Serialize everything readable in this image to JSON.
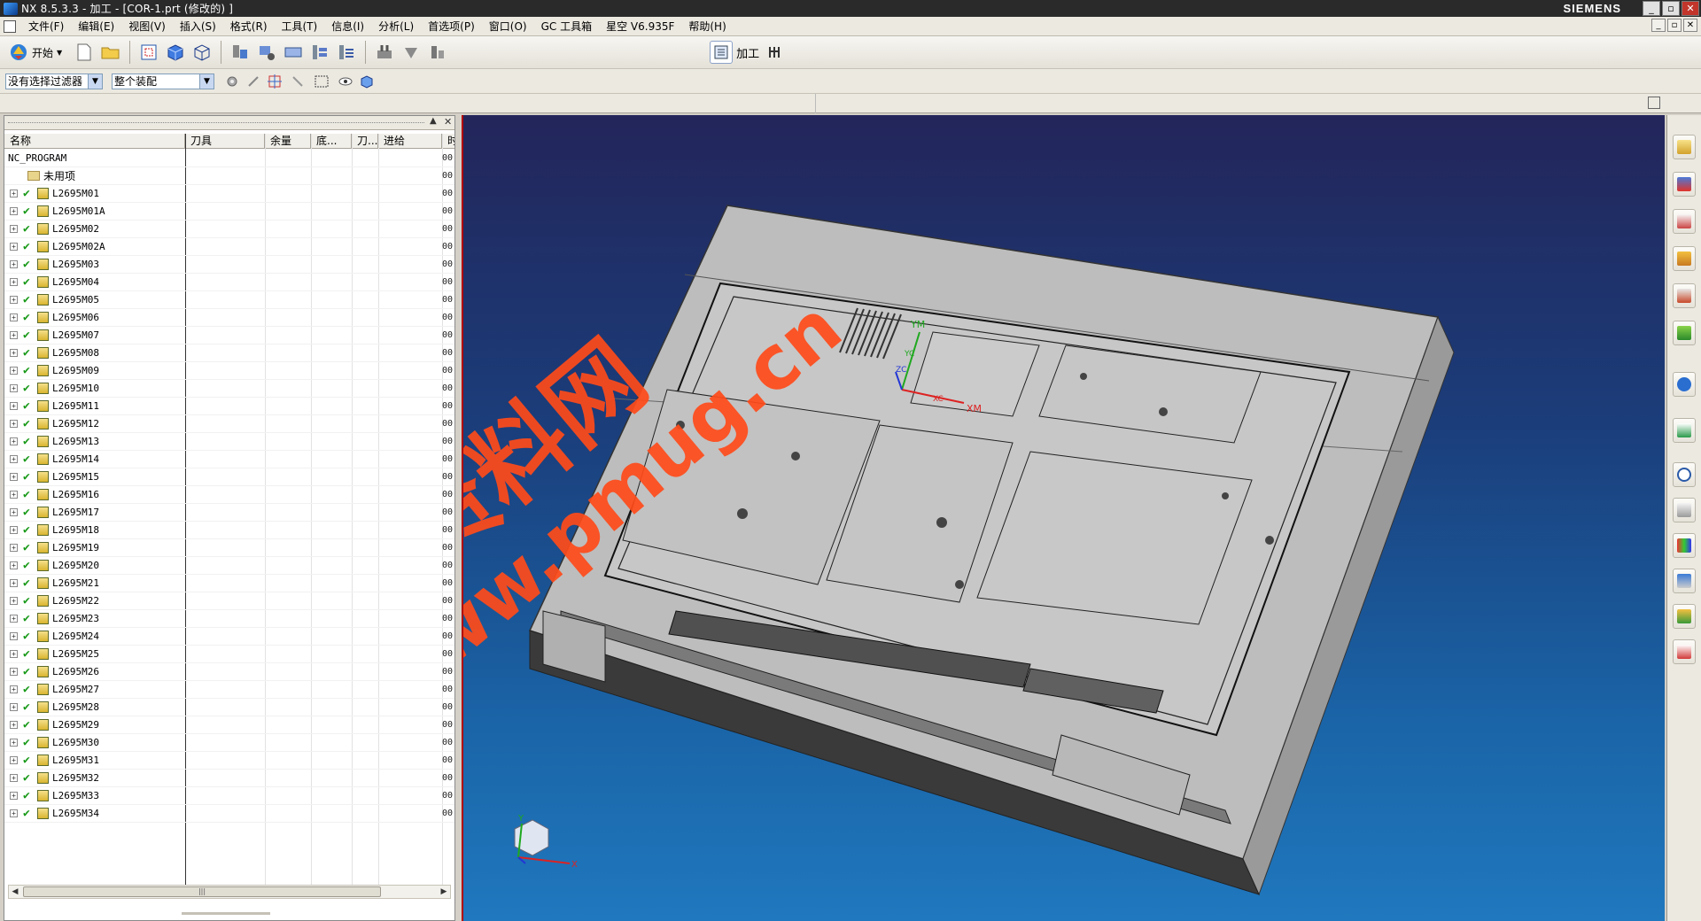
{
  "window": {
    "title": "NX 8.5.3.3 - 加工 - [COR-1.prt (修改的) ]",
    "brand": "SIEMENS",
    "min": "_",
    "max": "▫",
    "close": "✕"
  },
  "menubar": {
    "items": [
      "文件(F)",
      "编辑(E)",
      "视图(V)",
      "插入(S)",
      "格式(R)",
      "工具(T)",
      "信息(I)",
      "分析(L)",
      "首选项(P)",
      "窗口(O)",
      "GC 工具箱",
      "星空 V6.935F",
      "帮助(H)"
    ]
  },
  "toolbar": {
    "start_label": "开始",
    "right_btns": [
      "加工"
    ],
    "filter_select": "没有选择过滤器",
    "scope_select": "整个装配"
  },
  "navigator": {
    "columns": [
      "名称",
      "刀具",
      "余量",
      "底...",
      "刀...",
      "进给",
      "时"
    ],
    "root": "NC_PROGRAM",
    "unused": "未用项",
    "operations": [
      "L2695M01",
      "L2695M01A",
      "L2695M02",
      "L2695M02A",
      "L2695M03",
      "L2695M04",
      "L2695M05",
      "L2695M06",
      "L2695M07",
      "L2695M08",
      "L2695M09",
      "L2695M10",
      "L2695M11",
      "L2695M12",
      "L2695M13",
      "L2695M14",
      "L2695M15",
      "L2695M16",
      "L2695M17",
      "L2695M18",
      "L2695M19",
      "L2695M20",
      "L2695M21",
      "L2695M22",
      "L2695M23",
      "L2695M24",
      "L2695M25",
      "L2695M26",
      "L2695M27",
      "L2695M28",
      "L2695M29",
      "L2695M30",
      "L2695M31",
      "L2695M32",
      "L2695M33",
      "L2695M34"
    ],
    "time_prefix": "00"
  },
  "viewport": {
    "watermark_cn": "编程资料网",
    "watermark_url": "www.pmug.cn",
    "csys_labels": {
      "ym": "YM",
      "xm": "XM",
      "zc": "ZC",
      "yc": "YC",
      "xc": "XC"
    },
    "triad_labels": {
      "x": "X",
      "y": "Y",
      "z": "Z"
    }
  },
  "colors": {
    "accent_green": "#1a9a1a",
    "watermark": "#ff4b1a",
    "viewport_top": "#23255a",
    "viewport_bottom": "#2078be"
  }
}
